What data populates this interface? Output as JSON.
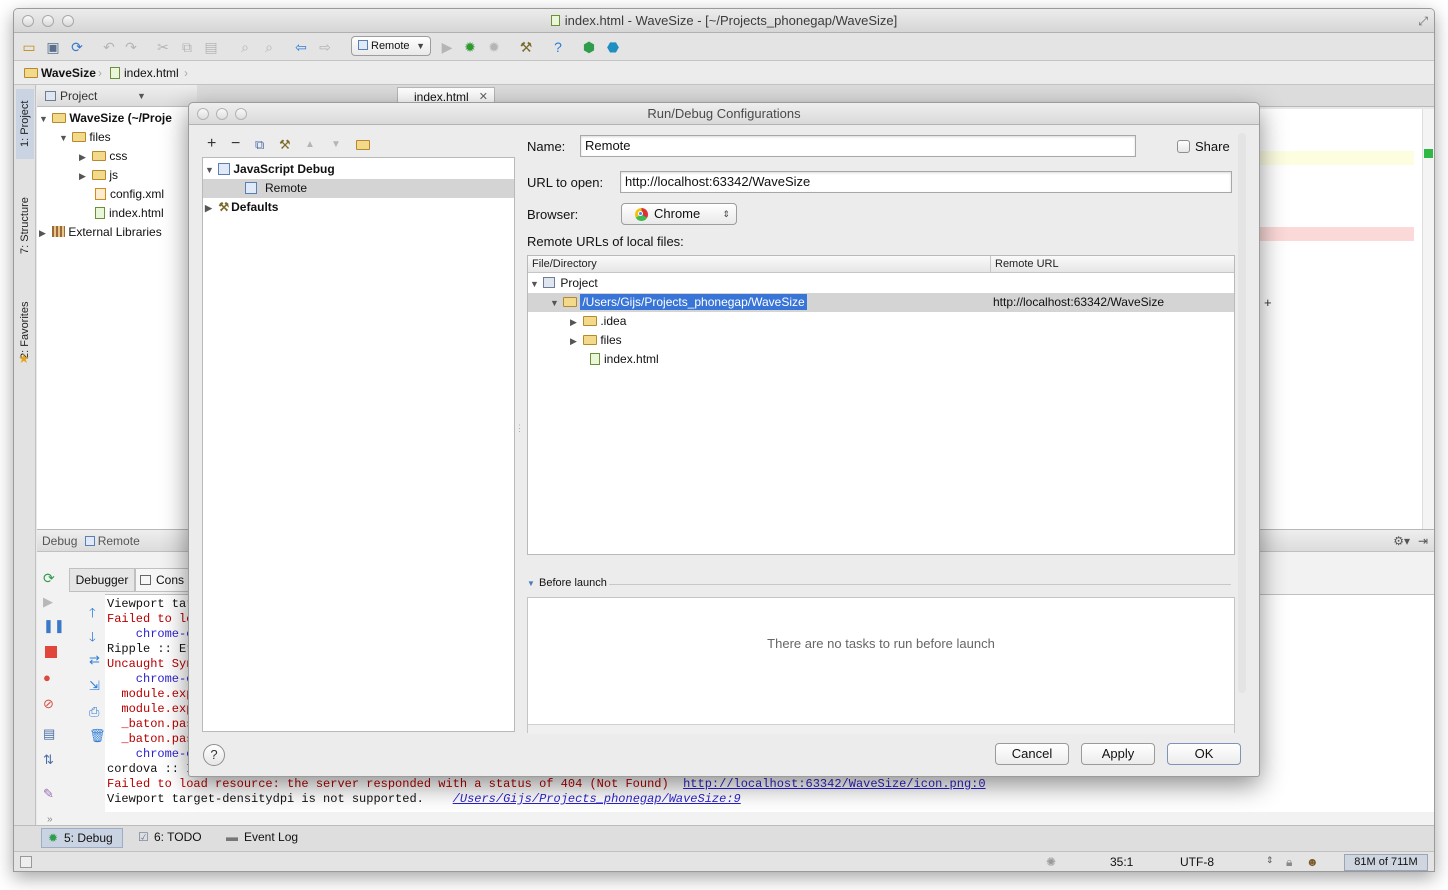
{
  "window": {
    "title": "index.html - WaveSize - [~/Projects_phonegap/WaveSize]"
  },
  "toolbar": {
    "run_config": "Remote"
  },
  "breadcrumb": {
    "project": "WaveSize",
    "file": "index.html"
  },
  "side_tabs": {
    "project": "1: Project",
    "structure": "7: Structure",
    "favorites": "2: Favorites"
  },
  "project_panel": {
    "header": "Project",
    "tree": [
      {
        "label": "WaveSize (~/Proje",
        "type": "module",
        "expanded": true
      },
      {
        "label": "files",
        "type": "folder",
        "expanded": true
      },
      {
        "label": "css",
        "type": "folder"
      },
      {
        "label": "js",
        "type": "folder"
      },
      {
        "label": "config.xml",
        "type": "xml"
      },
      {
        "label": "index.html",
        "type": "html"
      },
      {
        "label": "External Libraries",
        "type": "library"
      }
    ]
  },
  "editor": {
    "tab": "index.html"
  },
  "debug_panel": {
    "title_prefix": "Debug",
    "title_config": "Remote",
    "tabs": [
      "Debugger",
      "Cons"
    ],
    "console_lines": [
      {
        "text": "Viewport tar",
        "kind": "normal"
      },
      {
        "text": "Failed to lo",
        "kind": "error"
      },
      {
        "text": "    chrome-e",
        "kind": "error-link"
      },
      {
        "text": "Ripple :: Er",
        "kind": "normal"
      },
      {
        "text": "Uncaught Syn",
        "kind": "error"
      },
      {
        "text": "    chrome-e",
        "kind": "error-link"
      },
      {
        "text": "  module.exp",
        "kind": "error"
      },
      {
        "text": "  module.exp",
        "kind": "error"
      },
      {
        "text": "  _baton.pas",
        "kind": "error"
      },
      {
        "text": "  _baton.pas",
        "kind": "error"
      },
      {
        "text": "    chrome-e",
        "kind": "error-link"
      },
      {
        "text": "cordova :: I",
        "kind": "normal"
      },
      {
        "text": "Failed to load resource: the server responded with a status of 404 (Not Found)",
        "kind": "error"
      },
      {
        "text": "Viewport target-densitydpi is not supported.",
        "kind": "normal"
      }
    ],
    "error_link": "http://localhost:63342/WaveSize/icon.png:0",
    "source_link": "/Users/Gijs/Projects_phonegap/WaveSize:9"
  },
  "bottom_tabs": [
    {
      "label": "5: Debug",
      "active": true
    },
    {
      "label": "6: TODO",
      "active": false
    },
    {
      "label": "Event Log",
      "active": false
    }
  ],
  "status_bar": {
    "position": "35:1",
    "encoding": "UTF-8",
    "memory": "81M of 711M"
  },
  "dialog": {
    "title": "Run/Debug Configurations",
    "tree": {
      "group": "JavaScript Debug",
      "item": "Remote",
      "defaults": "Defaults"
    },
    "name_label": "Name:",
    "name_value": "Remote",
    "share_label": "Share",
    "share_checked": false,
    "url_label": "URL to open:",
    "url_value": "http://localhost:63342/WaveSize",
    "browser_label": "Browser:",
    "browser_value": "Chrome",
    "remote_urls_label": "Remote URLs of local files:",
    "table": {
      "col_file": "File/Directory",
      "col_remote": "Remote URL",
      "rows": [
        {
          "label": "Project",
          "remote": ""
        },
        {
          "label": "/Users/Gijs/Projects_phonegap/WaveSize",
          "remote": "http://localhost:63342/WaveSize"
        },
        {
          "label": ".idea",
          "remote": ""
        },
        {
          "label": "files",
          "remote": ""
        },
        {
          "label": "index.html",
          "remote": ""
        }
      ]
    },
    "before_launch_label": "Before launch",
    "before_launch_empty": "There are no tasks to run before launch",
    "buttons": {
      "cancel": "Cancel",
      "apply": "Apply",
      "ok": "OK"
    },
    "help_glyph": "?"
  },
  "colors": {
    "selection": "#3875d7",
    "error_text": "#b60000",
    "link": "#2a1fcc"
  }
}
